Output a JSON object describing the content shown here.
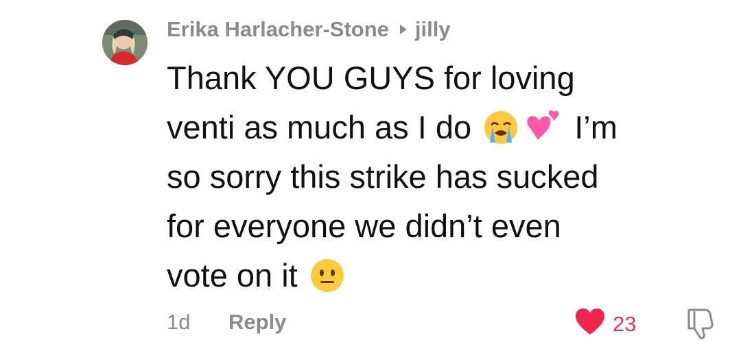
{
  "comment": {
    "author": "Erika Harlacher-Stone",
    "reply_to": "jilly",
    "text_lines": [
      "Thank YOU GUYS for loving",
      "venti as much as I do ",
      " I’m",
      "so sorry this strike has sucked",
      "for everyone we didn’t even",
      "vote on it "
    ],
    "emojis": [
      "loudly-crying-face",
      "two-hearts",
      "neutral-face"
    ],
    "time": "1d",
    "reply_label": "Reply",
    "like_count": "23",
    "colors": {
      "author": "#8a8a8f",
      "body": "#111111",
      "like": "#e8345a"
    }
  }
}
